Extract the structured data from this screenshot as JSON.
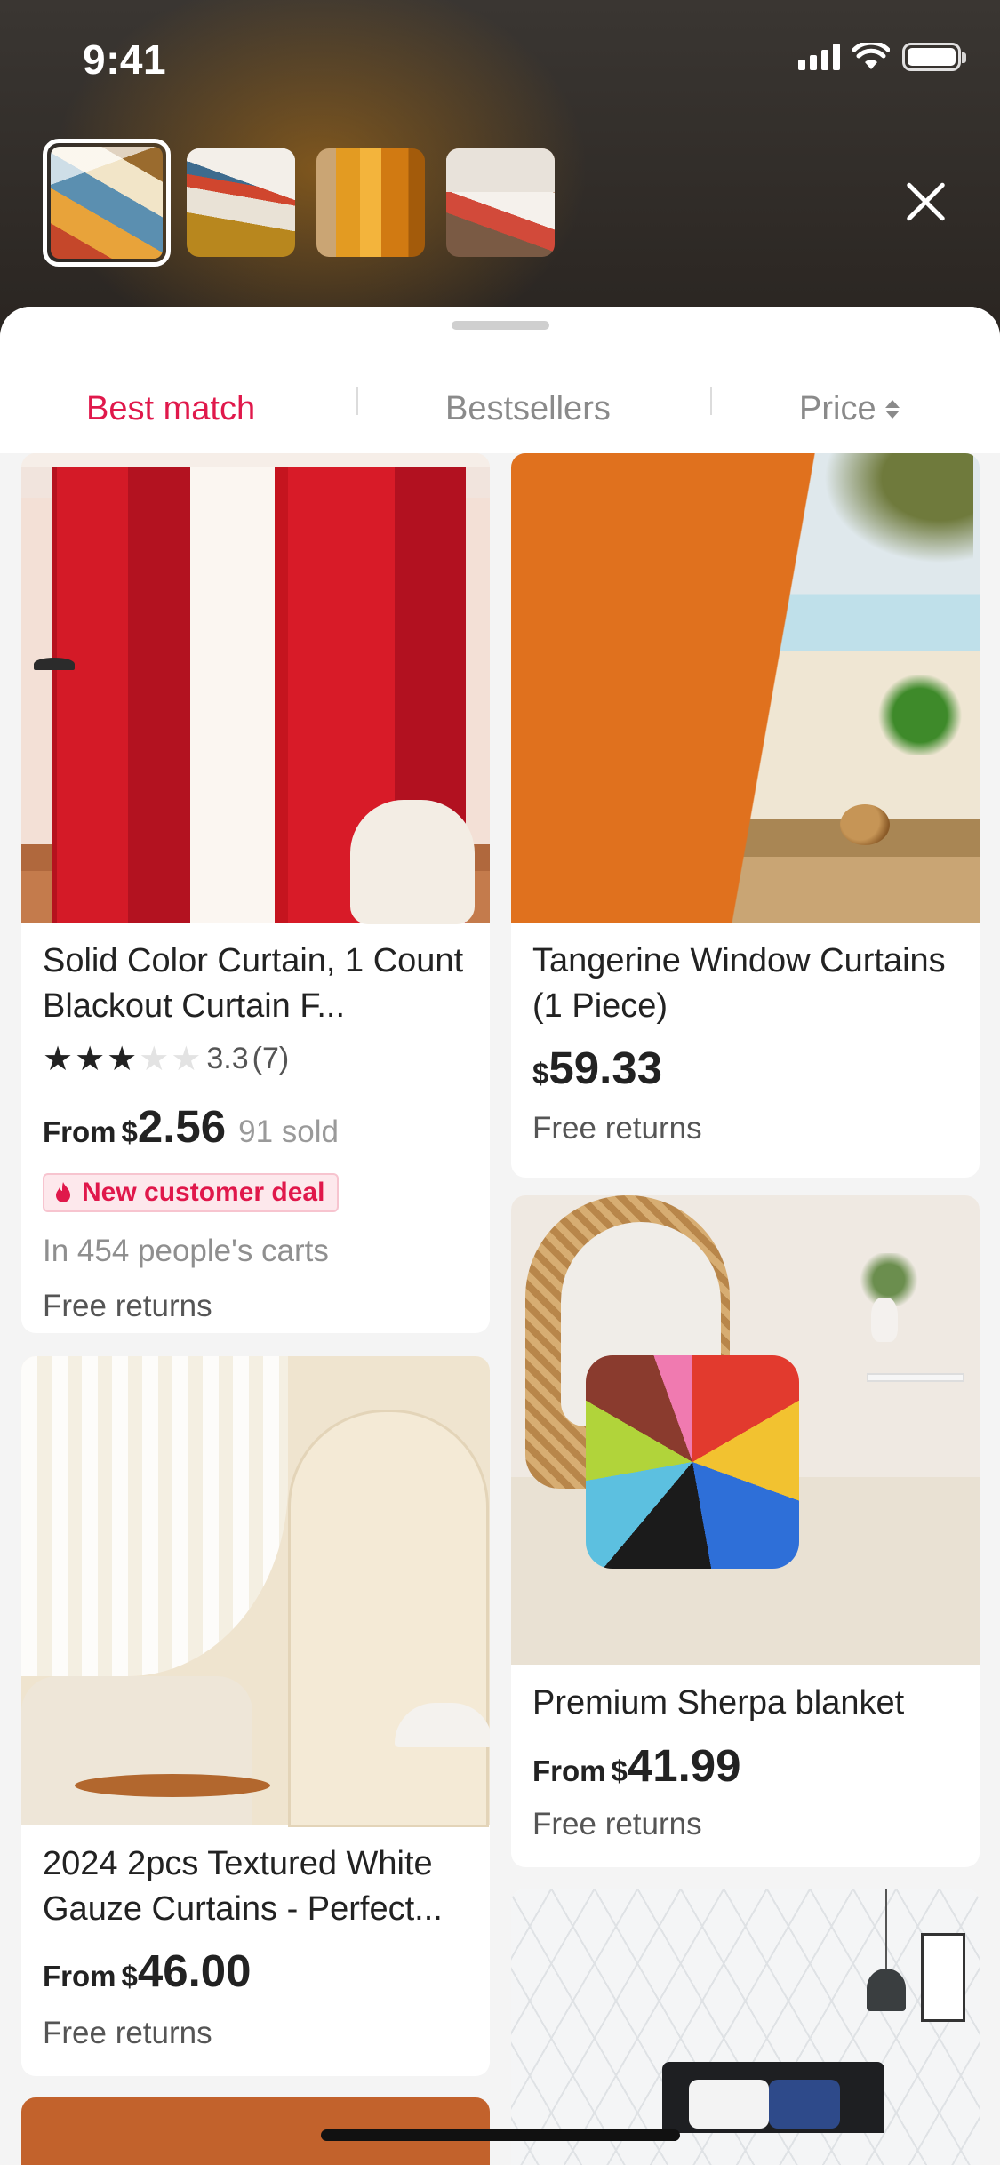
{
  "status_bar": {
    "time": "9:41"
  },
  "thumbnails": [
    {
      "name": "patchwork-bedding-thumb",
      "active": true
    },
    {
      "name": "bed-yellow-throw-thumb",
      "active": false
    },
    {
      "name": "orange-curtain-thumb",
      "active": false
    },
    {
      "name": "pillow-thumb",
      "active": false
    }
  ],
  "icons": {
    "close": "close-icon",
    "sort": "sort-icon",
    "flame": "flame-icon",
    "star": "star-icon"
  },
  "colors": {
    "accent": "#e0184b",
    "badge_bg": "#fde8ec"
  },
  "tabs": {
    "best_match": "Best match",
    "bestsellers": "Bestsellers",
    "price": "Price",
    "active": "best_match"
  },
  "products": [
    {
      "title": "Solid Color Curtain, 1 Count Blackout Curtain F...",
      "rating": 3.3,
      "rating_text": "3.3",
      "review_count": "(7)",
      "price_prefix": "From",
      "currency": "$",
      "price": "2.56",
      "sold": "91 sold",
      "badge": "New customer deal",
      "carts": "In 454 people's carts",
      "returns": "Free returns"
    },
    {
      "title": "Tangerine Window Curtains (1 Piece)",
      "currency": "$",
      "price": "59.33",
      "returns": "Free returns"
    },
    {
      "title": "2024 2pcs Textured White Gauze Curtains - Perfect...",
      "price_prefix": "From",
      "currency": "$",
      "price": "46.00",
      "returns": "Free returns"
    },
    {
      "title": "Premium Sherpa blanket",
      "price_prefix": "From",
      "currency": "$",
      "price": "41.99",
      "returns": "Free returns"
    }
  ]
}
